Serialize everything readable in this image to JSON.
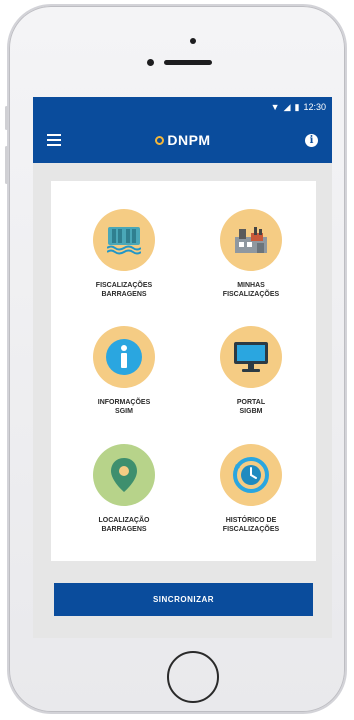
{
  "status_bar": {
    "time": "12:30"
  },
  "app_bar": {
    "logo_text": "DNPM"
  },
  "menu_tiles": [
    {
      "label_line1": "FISCALIZAÇÕES",
      "label_line2": "BARRAGENS",
      "icon": "dam-icon"
    },
    {
      "label_line1": "MINHAS",
      "label_line2": "FISCALIZAÇÕES",
      "icon": "factory-icon"
    },
    {
      "label_line1": "INFORMAÇÕES",
      "label_line2": "SGIM",
      "icon": "info-icon"
    },
    {
      "label_line1": "PORTAL",
      "label_line2": "SIGBM",
      "icon": "monitor-icon"
    },
    {
      "label_line1": "LOCALIZAÇÃO",
      "label_line2": "BARRAGENS",
      "icon": "map-pin-icon"
    },
    {
      "label_line1": "HISTÓRICO DE",
      "label_line2": "FISCALIZAÇÕES",
      "icon": "history-icon"
    }
  ],
  "sync_button": {
    "label": "SINCRONIZAR"
  },
  "colors": {
    "primary": "#0a4c9c",
    "accent": "#f4b73a",
    "tile_circle": "#f5cc84"
  }
}
